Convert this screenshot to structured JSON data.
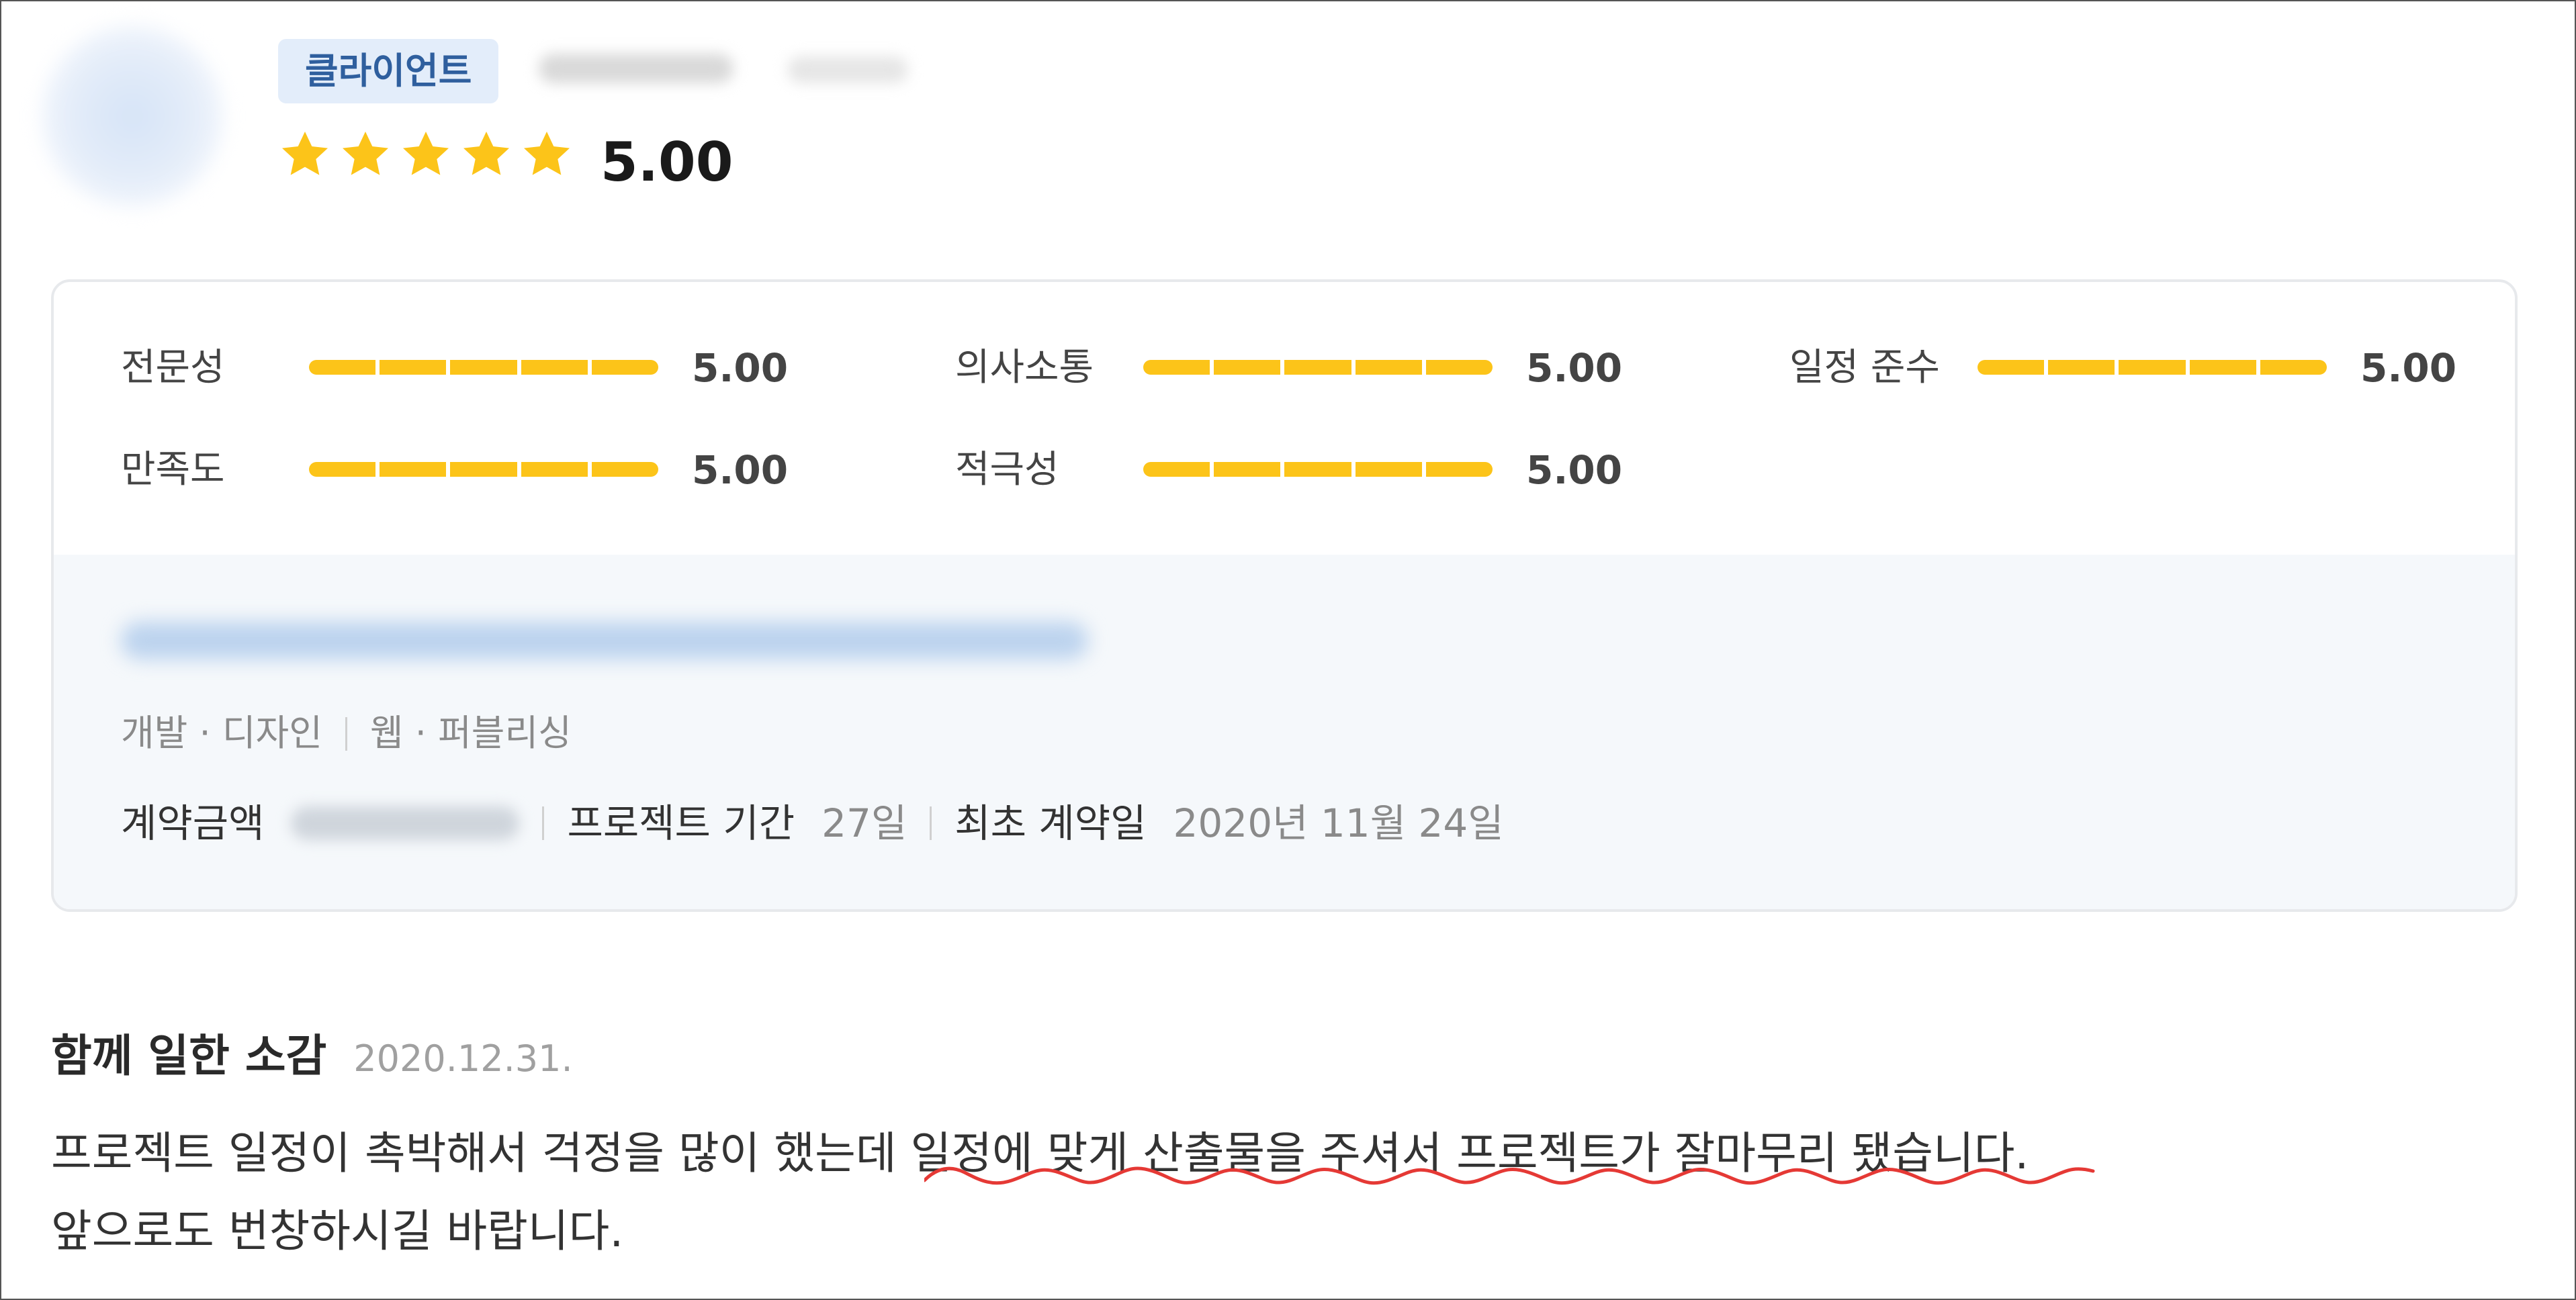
{
  "header": {
    "badge_label": "클라이언트",
    "overall_score": "5.00",
    "star_rating": 5,
    "star_max": 5
  },
  "metrics": [
    {
      "label": "전문성",
      "score": "5.00",
      "value": 5
    },
    {
      "label": "의사소통",
      "score": "5.00",
      "value": 5
    },
    {
      "label": "일정 준수",
      "score": "5.00",
      "value": 5
    },
    {
      "label": "만족도",
      "score": "5.00",
      "value": 5
    },
    {
      "label": "적극성",
      "score": "5.00",
      "value": 5
    }
  ],
  "project": {
    "category": [
      "개발 · 디자인",
      "웹 · 퍼블리싱"
    ],
    "contract_amount_label": "계약금액",
    "duration_label": "프로젝트 기간",
    "duration_value": "27일",
    "first_contract_label": "최초 계약일",
    "first_contract_value": "2020년 11월 24일"
  },
  "review": {
    "title": "함께 일한 소감",
    "date": "2020.12.31.",
    "lines": [
      "프로젝트 일정이 촉박해서 걱정을 많이 했는데 일정에 맞게 산출물을 주셔서 프로젝트가 잘마무리 됐습니다.",
      "앞으로도 번창하시길 바랍니다."
    ]
  },
  "colors": {
    "star": "#fcc419",
    "bar_fill": "#fcc419",
    "badge_bg": "#e3edfa",
    "badge_text": "#2f5f9e",
    "project_bg": "#f5f8fb",
    "squiggle": "#e53935"
  }
}
